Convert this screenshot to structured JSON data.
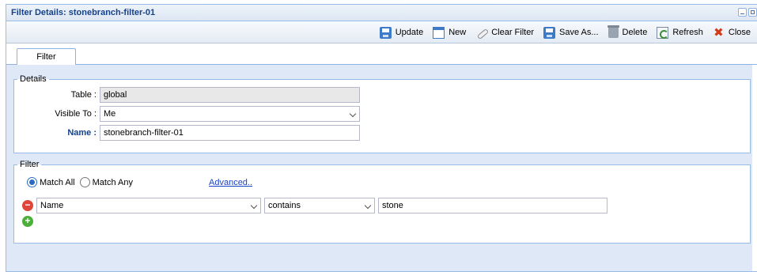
{
  "window": {
    "title": "Filter Details: stonebranch-filter-01"
  },
  "toolbar": {
    "buttons": [
      {
        "label": "Update",
        "icon": "save-icon"
      },
      {
        "label": "New",
        "icon": "new-document-icon"
      },
      {
        "label": "Clear Filter",
        "icon": "eraser-icon"
      },
      {
        "label": "Save As...",
        "icon": "save-icon"
      },
      {
        "label": "Delete",
        "icon": "trash-icon"
      },
      {
        "label": "Refresh",
        "icon": "refresh-icon"
      },
      {
        "label": "Close",
        "icon": "close-icon"
      }
    ]
  },
  "tabs": [
    {
      "label": "Filter"
    }
  ],
  "details": {
    "legend": "Details",
    "table_label": "Table :",
    "table_value": "global",
    "visible_label": "Visible To :",
    "visible_value": "Me",
    "name_label": "Name :",
    "name_value": "stonebranch-filter-01"
  },
  "filter": {
    "legend": "Filter",
    "match_all": "Match All",
    "match_any": "Match Any",
    "selected_match": "Match All",
    "advanced": "Advanced..",
    "rule": {
      "field": "Name",
      "operator": "contains",
      "value": "stone"
    }
  },
  "colors": {
    "accent": "#15428b",
    "border": "#99bbe8",
    "panel": "#dfe8f6"
  }
}
